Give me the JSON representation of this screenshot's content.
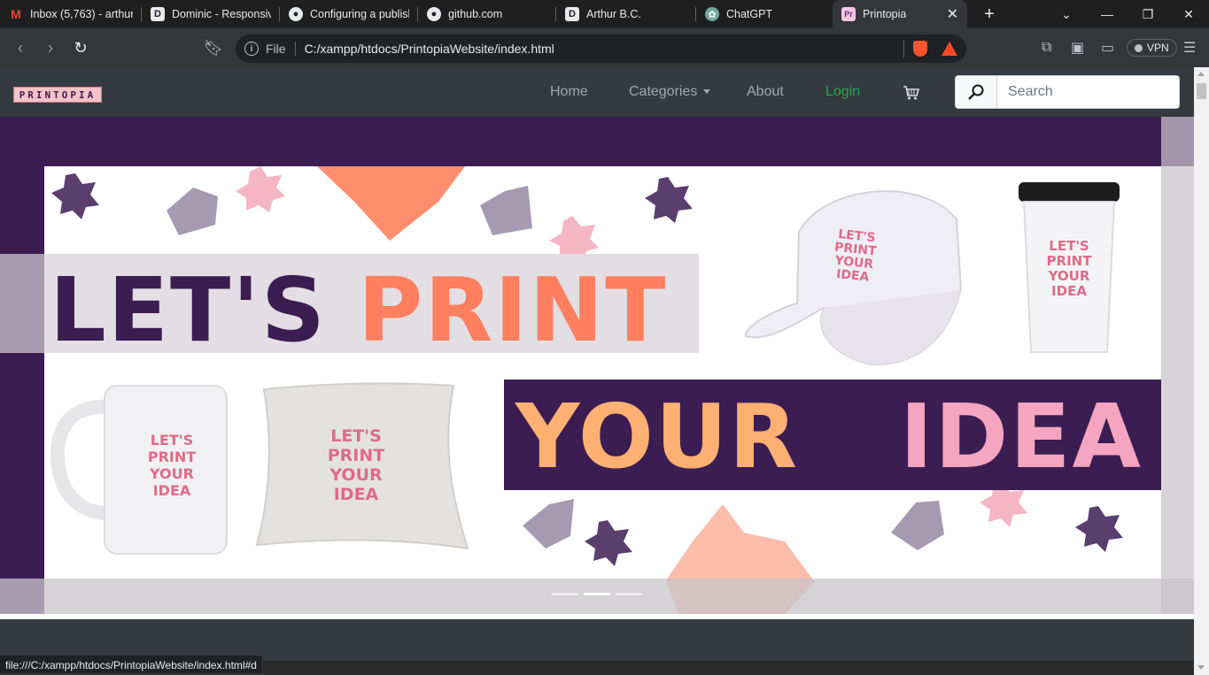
{
  "browser": {
    "tabs": [
      {
        "title": "Inbox (5,763) - arthur",
        "icon": "gmail-icon"
      },
      {
        "title": "Dominic - Responsive",
        "icon": "d-icon"
      },
      {
        "title": "Configuring a publish",
        "icon": "github-icon"
      },
      {
        "title": "github.com",
        "icon": "github-icon"
      },
      {
        "title": "Arthur B.C.",
        "icon": "d-icon"
      },
      {
        "title": "ChatGPT",
        "icon": "chatgpt-icon"
      },
      {
        "title": "Printopia",
        "icon": "printopia-icon",
        "active": true
      }
    ],
    "address": {
      "scheme_label": "File",
      "url": "C:/xampp/htdocs/PrintopiaWebsite/index.html"
    },
    "vpn_label": "VPN",
    "status_url": "file:///C:/xampp/htdocs/PrintopiaWebsite/index.html#d"
  },
  "site": {
    "brand": "PRINTOPIA",
    "nav": {
      "home": "Home",
      "categories": "Categories",
      "about": "About",
      "login": "Login"
    },
    "search": {
      "placeholder": "Search"
    }
  },
  "banner": {
    "line1_a": "LET'S",
    "line1_b": "PRINT",
    "line2_a": "YOUR",
    "line2_b": "IDEA",
    "product_print": "LET'S PRINT YOUR IDEA",
    "slides": 3,
    "active_slide": 2
  },
  "colors": {
    "dark_purple": "#3b1d52",
    "coral": "#ff7f5f",
    "peach": "#ffb072",
    "pink": "#f5a5bf",
    "navbar": "#343a40",
    "login_green": "#28a745"
  }
}
